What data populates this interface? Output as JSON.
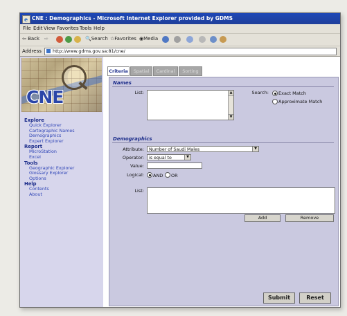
{
  "window": {
    "title": "CNE : Demographics - Microsoft Internet Explorer provided by GDMS"
  },
  "menu": [
    "File",
    "Edit",
    "View",
    "Favorites",
    "Tools",
    "Help"
  ],
  "toolbar": {
    "back": "Back",
    "search": "Search",
    "favorites": "Favorites",
    "media": "Media"
  },
  "address": {
    "label": "Address",
    "url": "http://www.gdms.gov.sa:81/cne/"
  },
  "logo": {
    "text": "CNE"
  },
  "sidebar": {
    "sections": [
      {
        "heading": "Explore",
        "items": [
          "Quick Explorer",
          "Cartographic Names",
          "Demographics",
          "Expert Explorer"
        ]
      },
      {
        "heading": "Report",
        "items": [
          "MicroStation",
          "Excel"
        ]
      },
      {
        "heading": "Tools",
        "items": [
          "Geographic Explorer",
          "Glossary Explorer",
          "Options"
        ]
      },
      {
        "heading": "Help",
        "items": [
          "Contents",
          "About"
        ]
      }
    ]
  },
  "tabs": [
    "Criteria",
    "Spatial",
    "Cardinal",
    "Sorting"
  ],
  "names": {
    "title": "Names",
    "list_label": "List:",
    "search_label": "Search:",
    "exact": "Exact Match",
    "approx": "Approximate Match"
  },
  "demographics": {
    "title": "Demographics",
    "attribute_label": "Attribute:",
    "attribute_value": "Number of Saudi Males",
    "operator_label": "Operator:",
    "operator_value": "is equal to",
    "value_label": "Value:",
    "value_value": "",
    "logical_label": "Logical:",
    "and": "AND",
    "or": "OR",
    "list_label": "List:",
    "add": "Add",
    "remove": "Remove"
  },
  "actions": {
    "submit": "Submit",
    "reset": "Reset"
  }
}
